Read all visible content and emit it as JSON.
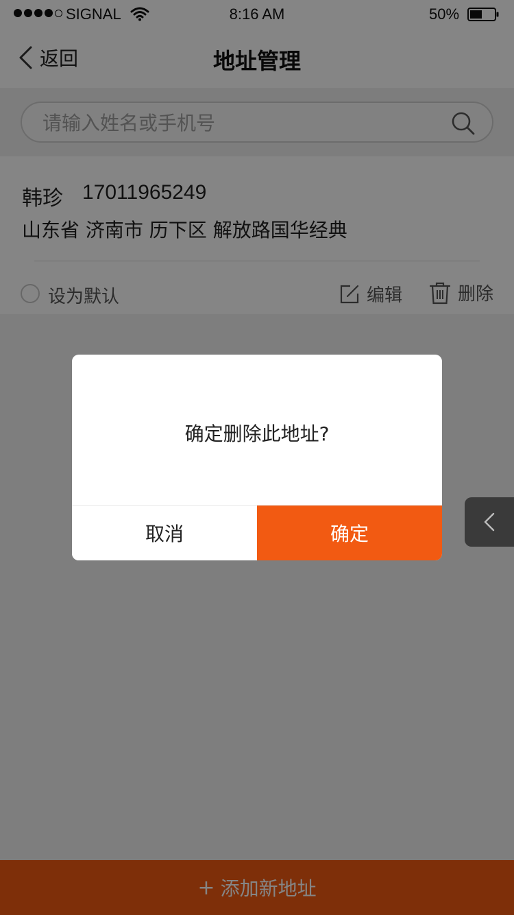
{
  "status_bar": {
    "carrier": "SIGNAL",
    "time": "8:16 AM",
    "battery": "50%",
    "battery_level": 0.5
  },
  "nav": {
    "back_label": "返回",
    "title": "地址管理"
  },
  "search": {
    "placeholder": "请输入姓名或手机号",
    "value": ""
  },
  "address": {
    "name": "韩珍",
    "phone": "17011965249",
    "detail": "山东省 济南市 历下区 解放路国华经典",
    "default_label": "设为默认",
    "is_default": false,
    "edit_label": "编辑",
    "delete_label": "删除"
  },
  "add_button": {
    "plus": "+",
    "label": "添加新地址"
  },
  "dialog": {
    "message": "确定删除此地址?",
    "cancel_label": "取消",
    "confirm_label": "确定"
  },
  "colors": {
    "accent": "#f25a12",
    "overlay": "rgba(0,0,0,0.48)"
  },
  "icons": {
    "back": "chevron-left-icon",
    "search": "search-icon",
    "edit": "edit-icon",
    "delete": "trash-icon",
    "side_tab": "chevron-left-icon",
    "wifi": "wifi-icon",
    "battery": "battery-icon"
  }
}
